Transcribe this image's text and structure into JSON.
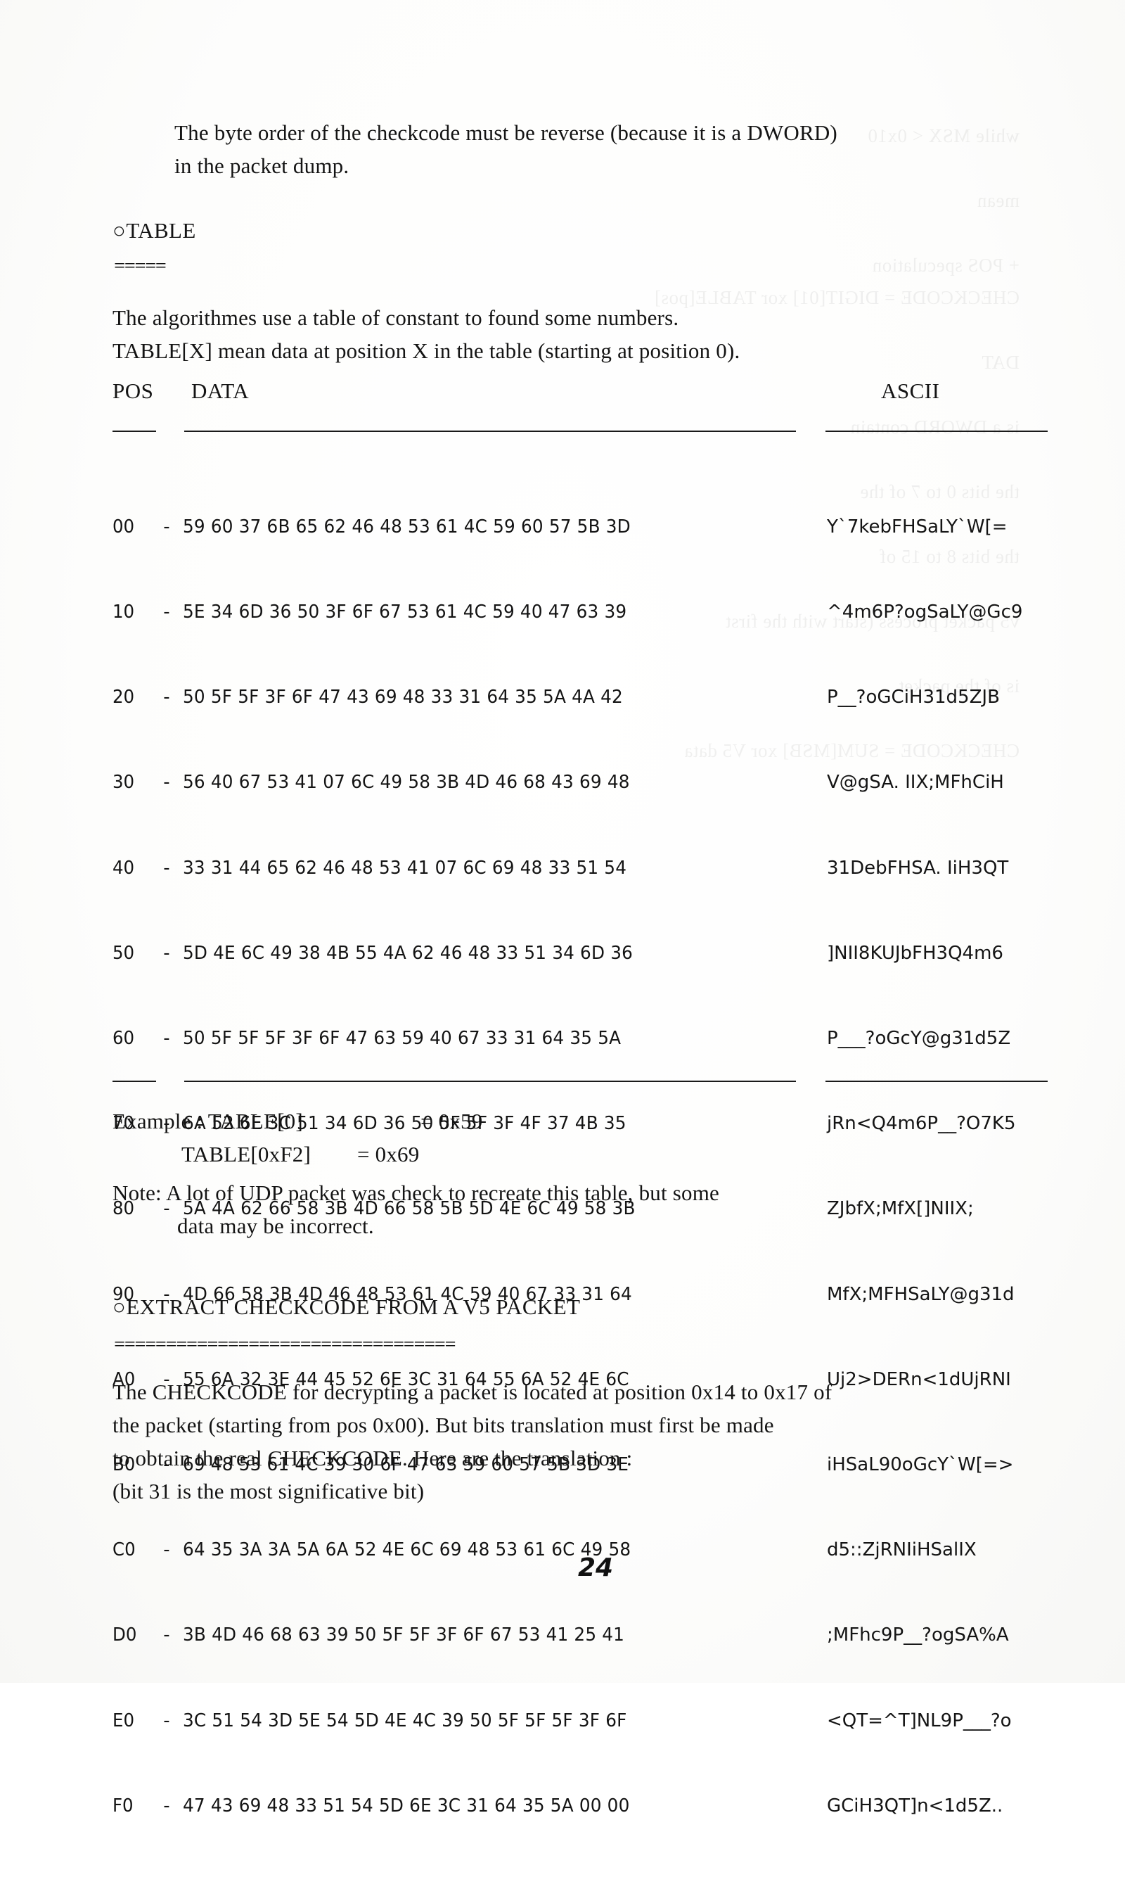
{
  "document": {
    "page_number": "24",
    "intro_paragraph": "The byte order of the checkcode must be reverse (because it is a DWORD)\nin the packet dump.",
    "table_heading": {
      "bullet": "○",
      "text": "TABLE",
      "underline": "====="
    },
    "table_intro_line1": "The algorithmes use a table of constant to found some numbers.",
    "table_intro_line2": "TABLE[X] mean data at position X in the table (starting at position 0).",
    "columns": {
      "pos": "POS",
      "data": "DATA",
      "ascii": "ASCII"
    },
    "rows": [
      {
        "pos": "00",
        "sep": "-",
        "bytes": "59 60 37 6B 65 62 46 48 53 61 4C 59 60 57 5B 3D",
        "ascii": "Y`7kebFHSaLY`W[="
      },
      {
        "pos": "10",
        "sep": "-",
        "bytes": "5E 34 6D 36 50 3F 6F 67 53 61 4C 59 40 47 63 39",
        "ascii": "^4m6P?ogSaLY@Gc9"
      },
      {
        "pos": "20",
        "sep": "-",
        "bytes": "50 5F 5F 3F 6F 47 43 69 48 33 31 64 35 5A 4A 42",
        "ascii": "P__?oGCiH31d5ZJB"
      },
      {
        "pos": "30",
        "sep": "-",
        "bytes": "56 40 67 53 41 07 6C 49 58 3B 4D 46 68 43 69 48",
        "ascii": "V@gSA. IIX;MFhCiH"
      },
      {
        "pos": "40",
        "sep": "-",
        "bytes": "33 31 44 65 62 46 48 53 41 07 6C 69 48 33 51 54",
        "ascii": "31DebFHSA. IiH3QT"
      },
      {
        "pos": "50",
        "sep": "-",
        "bytes": "5D 4E 6C 49 38 4B 55 4A 62 46 48 33 51 34 6D 36",
        "ascii": "]NII8KUJbFH3Q4m6"
      },
      {
        "pos": "60",
        "sep": "-",
        "bytes": "50 5F 5F 5F 3F 6F 47 63 59 40 67 33 31 64 35 5A",
        "ascii": "P___?oGcY@g31d5Z"
      },
      {
        "pos": "70",
        "sep": "-",
        "bytes": "6A 52 6E 3C 51 34 6D 36 50 5F 5F 3F 4F 37 4B 35",
        "ascii": "jRn<Q4m6P__?O7K5"
      },
      {
        "pos": "80",
        "sep": "-",
        "bytes": "5A 4A 62 66 58 3B 4D 66 58 5B 5D 4E 6C 49 58 3B",
        "ascii": "ZJbfX;MfX[]NIIX;"
      },
      {
        "pos": "90",
        "sep": "-",
        "bytes": "4D 66 58 3B 4D 46 48 53 61 4C 59 40 67 33 31 64",
        "ascii": "MfX;MFHSaLY@g31d"
      },
      {
        "pos": "A0",
        "sep": "-",
        "bytes": "55 6A 32 3E 44 45 52 6E 3C 31 64 55 6A 52 4E 6C",
        "ascii": "Uj2>DERn<1dUjRNI"
      },
      {
        "pos": "B0",
        "sep": "-",
        "bytes": "69 48 53 61 4C 39 30 6F 47 63 59 60 57 5B 3D 3E",
        "ascii": "iHSaL90oGcY`W[=>"
      },
      {
        "pos": "C0",
        "sep": "-",
        "bytes": "64 35 3A 3A 5A 6A 52 4E 6C 69 48 53 61 6C 49 58",
        "ascii": "d5::ZjRNIiHSalIX"
      },
      {
        "pos": "D0",
        "sep": "-",
        "bytes": "3B 4D 46 68 63 39 50 5F 5F 3F 6F 67 53 41 25 41",
        "ascii": ";MFhc9P__?ogSA%A"
      },
      {
        "pos": "E0",
        "sep": "-",
        "bytes": "3C 51 54 3D 5E 54 5D 4E 4C 39 50 5F 5F 5F 3F 6F",
        "ascii": "<QT=^T]NL9P___?o"
      },
      {
        "pos": "F0",
        "sep": "-",
        "bytes": "47 43 69 48 33 51 54 5D 6E 3C 31 64 35 5A 00 00",
        "ascii": "GCiH3QT]n<1d5Z.."
      }
    ],
    "example": {
      "line1_label": "Example : TABLE[0]",
      "line1_value": "= 0x59",
      "line2_label": "TABLE[0xF2]",
      "line2_value": "= 0x69"
    },
    "note_line1": "Note: A lot of UDP packet was check to recreate this table, but some",
    "note_line2": "data may be incorrect.",
    "extract_heading": {
      "bullet": "○",
      "text": "EXTRACT CHECKCODE FROM A V5 PACKET",
      "underline": "================================="
    },
    "extract_paragraph": "The CHECKCODE for decrypting a packet is located at position 0x14 to 0x17 of\nthe packet (starting from pos 0x00). But bits translation must first be made\nto obtain the real CHECKCODE. Here are the translation :\n(bit 31 is the most significative bit)"
  },
  "bleed_text": "while MSX < 0x10\n\nmean\n\n+ POS speculation\nCHECKCODE = DIGIT[01] xor TABLE[pos]\n\nDAT\n\nis a DWORD contain\n\nthe bits 0 to 7 of the\n\nthe bits 8 to 15 of\n\nv5 packet process (start with the first\n\nis of the packet\n\nCHECKCODE = SUM[MSB] xor V5 data"
}
